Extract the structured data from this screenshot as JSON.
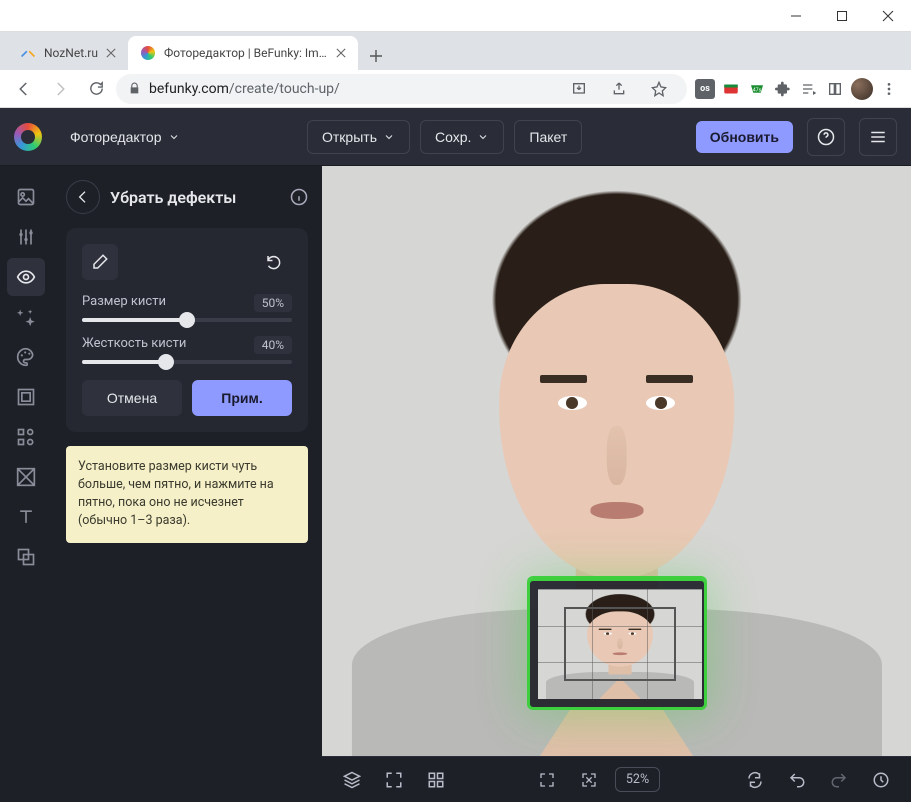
{
  "window": {
    "tabs": [
      {
        "title": "NozNet.ru",
        "active": false
      },
      {
        "title": "Фоторедактор | BeFunky: Image",
        "active": true
      }
    ]
  },
  "browser": {
    "url_host": "befunky.com",
    "url_path": "/create/touch-up/"
  },
  "header": {
    "editor_label": "Фоторедактор",
    "open_label": "Открыть",
    "save_label": "Сохр.",
    "batch_label": "Пакет",
    "upgrade_label": "Обновить"
  },
  "panel": {
    "title": "Убрать дефекты",
    "brush_size_label": "Размер кисти",
    "brush_size_value": "50%",
    "brush_size_pct": 50,
    "hardness_label": "Жесткость кисти",
    "hardness_value": "40%",
    "hardness_pct": 40,
    "cancel_label": "Отмена",
    "apply_label": "Прим.",
    "hint_text": "Установите размер кисти чуть больше, чем пятно, и нажмите на пятно, пока оно не исчезнет (обычно 1–3 раза)."
  },
  "bottombar": {
    "zoom_value": "52%"
  }
}
